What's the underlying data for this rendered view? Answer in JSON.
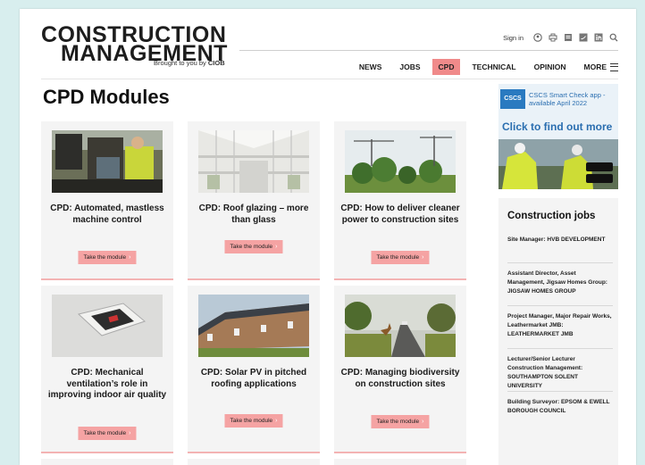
{
  "header": {
    "logo_line1": "CONSTRUCTION",
    "logo_line2": "MANAGEMENT",
    "logo_sub_prefix": "Brought to you by ",
    "logo_sub_brand": "CIOB",
    "signin": "Sign in",
    "icons": [
      "user-icon",
      "print-icon",
      "rss-icon",
      "twitter-icon",
      "linkedin-icon",
      "search-icon"
    ],
    "nav": [
      "NEWS",
      "JOBS",
      "CPD",
      "TECHNICAL",
      "OPINION"
    ],
    "nav_active": "CPD",
    "nav_more": "MORE"
  },
  "page_title": "CPD Modules",
  "cards": [
    {
      "title": "CPD: Automated, mastless machine control",
      "button": "Take the module"
    },
    {
      "title": "CPD: Roof glazing – more than glass",
      "button": "Take the module"
    },
    {
      "title": "CPD: How to deliver cleaner power to construction sites",
      "button": "Take the module"
    },
    {
      "title": "CPD: Mechanical ventilation’s role in improving indoor air quality",
      "button": "Take the module"
    },
    {
      "title": "CPD: Solar PV in pitched roofing applications",
      "button": "Take the module"
    },
    {
      "title": "CPD: Managing biodiversity on construction sites",
      "button": "Take the module"
    }
  ],
  "ad": {
    "badge": "CSCS",
    "text": "CSCS Smart Check app - available April 2022",
    "cta": "Click to find out more"
  },
  "jobs": {
    "title": "Construction jobs",
    "items": [
      "Site Manager: HVB DEVELOPMENT",
      "Assistant Director, Asset Management, Jigsaw Homes Group: JIGSAW HOMES GROUP",
      "Project Manager, Major Repair Works, Leathermarket JMB: LEATHERMARKET JMB",
      "Lecturer/Senior Lecturer Construction Management: SOUTHAMPTON SOLENT UNIVERSITY",
      "Building Surveyor: EPSOM & EWELL BOROUGH COUNCIL"
    ]
  }
}
